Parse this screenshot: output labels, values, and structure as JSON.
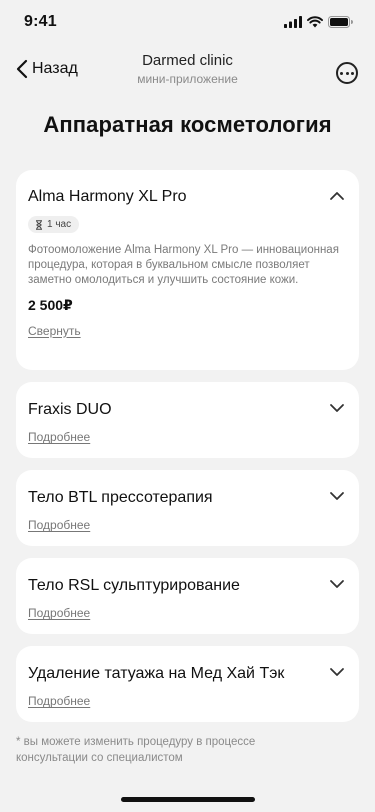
{
  "status": {
    "time": "9:41"
  },
  "nav": {
    "back_label": "Назад",
    "title": "Darmed clinic",
    "subtitle": "мини-приложение"
  },
  "page": {
    "title": "Аппаратная косметология"
  },
  "procedures": [
    {
      "title": "Alma Harmony XL Pro",
      "duration": "1 час",
      "description": "Фотоомоложение Alma Harmony XL Pro — инновационная процедура, которая в буквальном смысле позволяет заметно омолодиться и улучшить состояние кожи.",
      "price": "2 500₽",
      "link": "Свернуть",
      "expanded": true
    },
    {
      "title": "Fraxis DUO",
      "link": "Подробнее",
      "expanded": false
    },
    {
      "title": "Тело BTL прессотерапия",
      "link": "Подробнее",
      "expanded": false
    },
    {
      "title": "Тело RSL сульптурирование",
      "link": "Подробнее",
      "expanded": false
    },
    {
      "title": "Удаление татуажа на Мед Хай Тэк",
      "link": "Подробнее",
      "expanded": false
    }
  ],
  "footnote": "* вы можете изменить процедуру в процессе консультации со специалистом",
  "icons": {
    "back": "chevron-left-icon",
    "more": "more-icon",
    "expand": "chevron-down-icon",
    "collapse": "chevron-up-icon",
    "duration": "hourglass-icon"
  }
}
